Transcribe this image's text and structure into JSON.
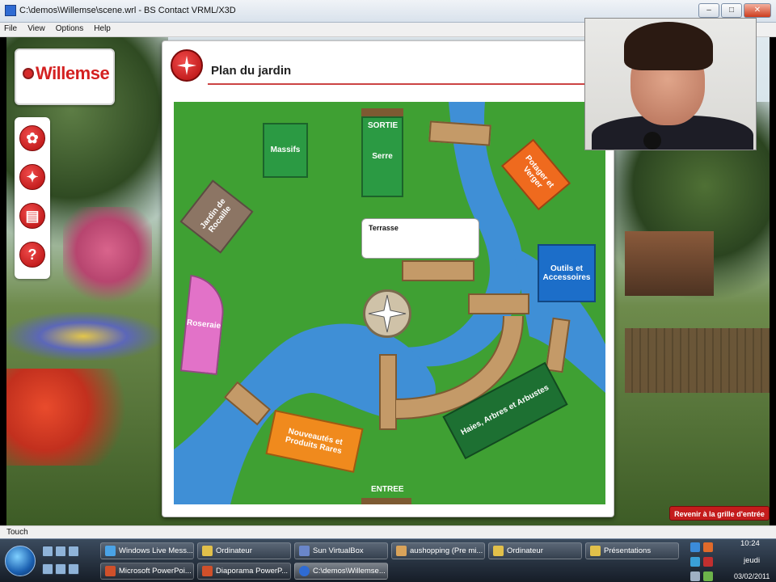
{
  "window": {
    "title": "C:\\demos\\Willemse\\scene.wrl - BS Contact VRML/X3D",
    "minimize": "–",
    "maximize": "□",
    "close": "✕"
  },
  "menu": {
    "file": "File",
    "view": "View",
    "options": "Options",
    "help": "Help"
  },
  "logo": {
    "text": "Willemse",
    "brand_color": "#d42121"
  },
  "toolbar": {
    "items": [
      {
        "icon": "flower-icon",
        "glyph": "✿"
      },
      {
        "icon": "compass-icon",
        "glyph": "✦"
      },
      {
        "icon": "document-icon",
        "glyph": "▤"
      },
      {
        "icon": "help-icon",
        "glyph": "?"
      }
    ]
  },
  "dialog": {
    "title": "Plan du jardin",
    "zones": {
      "massifs": "Massifs",
      "serre": "Serre",
      "sortie": "SORTIE",
      "potager": "Potager et Verger",
      "rocaille": "Jardin de Rocaille",
      "terrasse": "Terrasse",
      "outils": "Outils et Accessoires",
      "roseraie": "Roseraie",
      "haies": "Haies, Arbres et Arbustes",
      "nouveautes": "Nouveautés et Produits Rares",
      "entree": "ENTREE"
    }
  },
  "return_button": "Revenir à la grille d'entrée",
  "status": "Touch",
  "taskbar": {
    "tasks_top": [
      "Windows Live Mess...",
      "Ordinateur",
      "Sun VirtualBox",
      "aushopping (Pre mi...",
      "Ordinateur",
      "Présentations"
    ],
    "tasks_bottom": [
      "Microsoft PowerPoi...",
      "Diaporama PowerP...",
      "C:\\demos\\Willemse..."
    ],
    "clock_time": "10:24",
    "clock_day": "jeudi",
    "clock_date": "03/02/2011"
  },
  "colors": {
    "accent_red": "#c41c1c",
    "lawn": "#3fa033",
    "water": "#3f8fd6",
    "path": "#c49a68"
  }
}
